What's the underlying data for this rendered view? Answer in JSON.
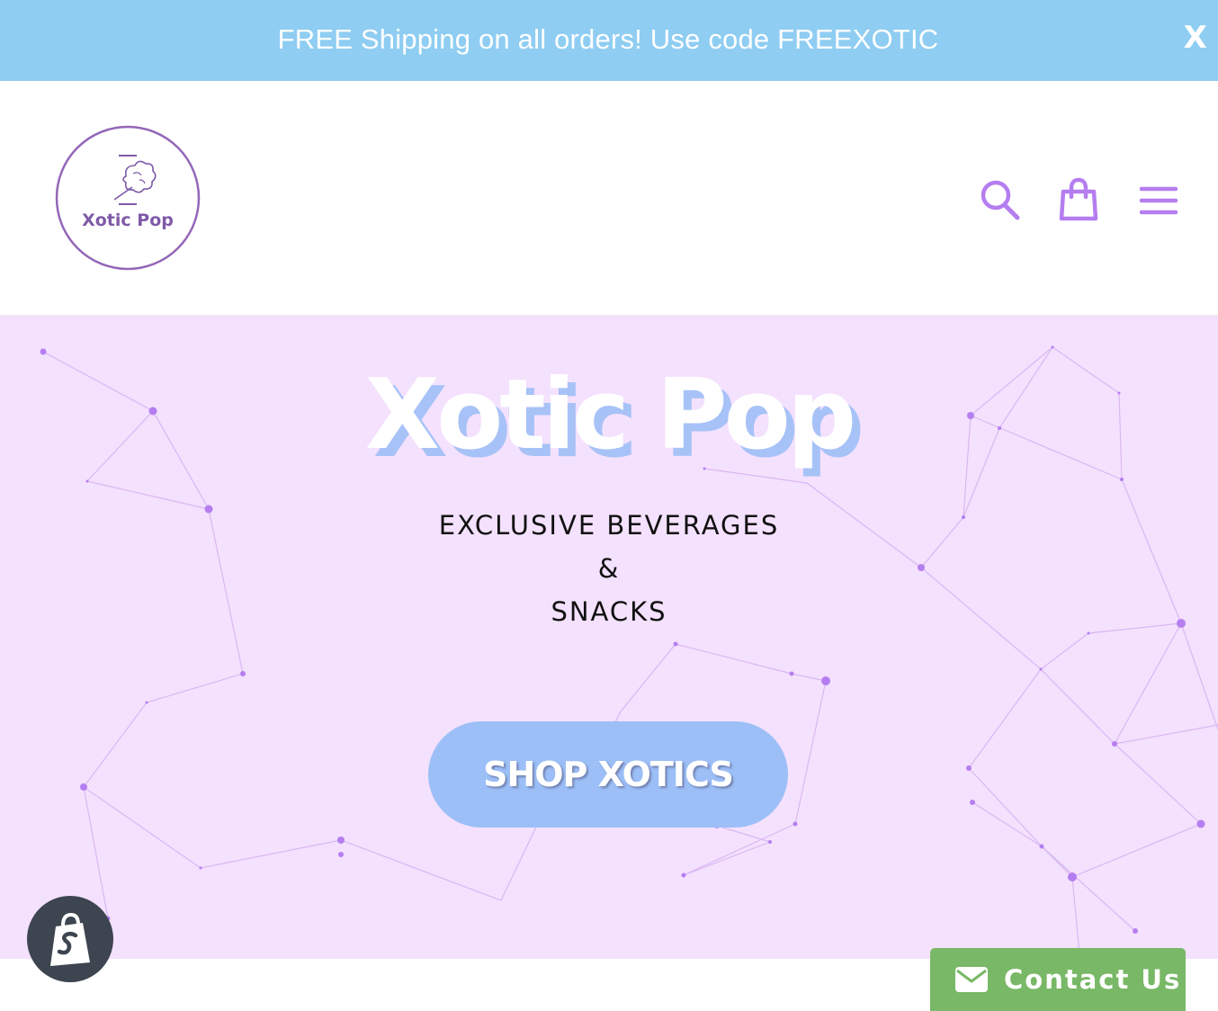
{
  "announcement": {
    "text": "FREE Shipping on all orders! Use code FREEXOTIC",
    "close_label": "X",
    "background": "#8fcdf2"
  },
  "header": {
    "logo_text": "Xotic Pop",
    "icons": [
      "search-icon",
      "cart-icon",
      "menu-icon"
    ],
    "icon_color": "#b57ef0"
  },
  "hero": {
    "title": "Xotic Pop",
    "subtitle_lines": [
      "EXCLUSIVE BEVERAGES",
      "&",
      "SNACKS"
    ],
    "cta_label": "SHOP XOTICS",
    "background": "#f4e1fd",
    "cta_color": "#9cbff7"
  },
  "widgets": {
    "shopify_badge_icon": "shopify-bag-icon",
    "contact_label": "Contact Us",
    "contact_icon": "envelope-icon",
    "contact_color": "#79b866"
  }
}
